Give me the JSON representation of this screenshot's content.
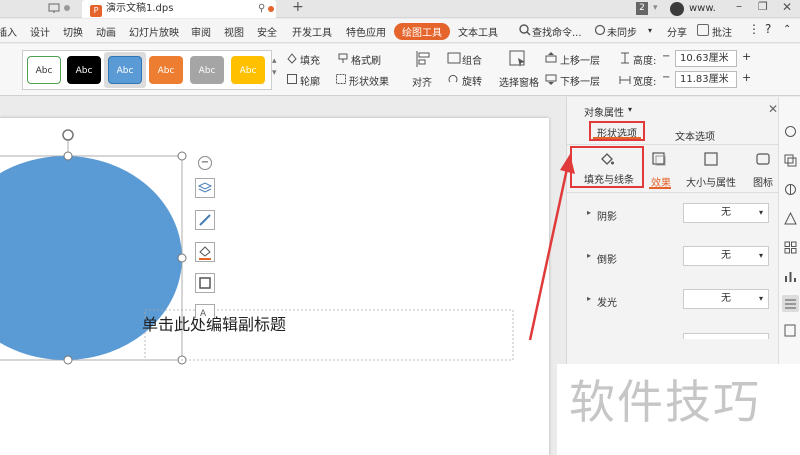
{
  "titlebar": {
    "tab_label": "演示文稿1.dps",
    "tab_badge": "2",
    "user_label": "www."
  },
  "menu": [
    "插入",
    "设计",
    "切换",
    "动画",
    "幻灯片放映",
    "审阅",
    "视图",
    "安全",
    "开发工具",
    "特色应用",
    "绘图工具",
    "文本工具"
  ],
  "menu_active": "绘图工具",
  "search": {
    "label": "查找命令..."
  },
  "right_menu": {
    "sync": "未同步",
    "share": "分享",
    "comment": "批注"
  },
  "ribbon": {
    "styles": [
      {
        "label": "Abc",
        "bg": "#ffffff",
        "fg": "#333333",
        "border": "#4f9f4f"
      },
      {
        "label": "Abc",
        "bg": "#000000",
        "fg": "#ffffff",
        "border": "#000000"
      },
      {
        "label": "Abc",
        "bg": "#5b9bd5",
        "fg": "#ffffff",
        "border": "#2e75b6"
      },
      {
        "label": "Abc",
        "bg": "#ed7d31",
        "fg": "#ffffff",
        "border": "#ed7d31"
      },
      {
        "label": "Abc",
        "bg": "#a5a5a5",
        "fg": "#ffffff",
        "border": "#a5a5a5"
      },
      {
        "label": "Abc",
        "bg": "#ffc000",
        "fg": "#ffffff",
        "border": "#ffc000"
      }
    ],
    "fill": "填充",
    "format_brush": "格式刷",
    "outline": "轮廓",
    "shape_effect": "形状效果",
    "align": "对齐",
    "group": "组合",
    "rotate": "旋转",
    "selection_pane": "选择窗格",
    "bring_forward": "上移一层",
    "send_backward": "下移一层",
    "height_label": "高度:",
    "height_value": "10.63厘米",
    "width_label": "宽度:",
    "width_value": "11.83厘米"
  },
  "slide": {
    "subtitle_placeholder": "单击此处编辑副标题",
    "shape_color": "#5b9bd5"
  },
  "panel": {
    "title": "对象属性",
    "tab_shape": "形状选项",
    "tab_text": "文本选项",
    "sub_fill": "填充与线条",
    "sub_effect": "效果",
    "sub_size": "大小与属性",
    "sub_picture": "图标",
    "rows": [
      {
        "label": "阴影",
        "value": "无"
      },
      {
        "label": "倒影",
        "value": "无"
      },
      {
        "label": "发光",
        "value": "无"
      }
    ]
  },
  "watermark": "软件技巧",
  "accent": "#e4642b",
  "highlight": "#e03a3a"
}
